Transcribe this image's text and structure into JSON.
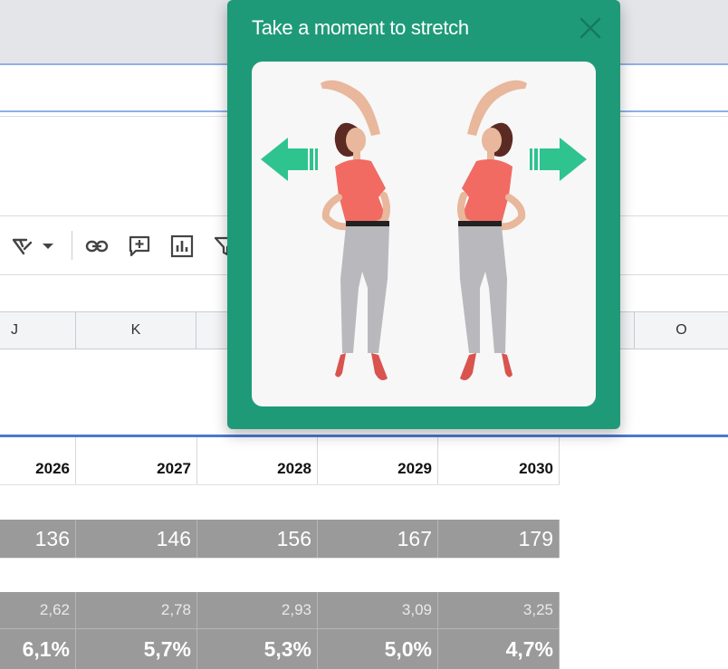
{
  "popup": {
    "title": "Take a moment to stretch",
    "close_icon": "close-icon",
    "illustration": "stretching-women-illustration",
    "arrow_left_icon": "arrow-left-icon",
    "arrow_right_icon": "arrow-right-icon"
  },
  "toolbar": {
    "icons": [
      "text-format-icon",
      "chevron-down-icon",
      "link-icon",
      "add-comment-icon",
      "insert-chart-icon",
      "filter-icon"
    ]
  },
  "column_headers": [
    "J",
    "K",
    "O"
  ],
  "sheet": {
    "years": [
      "2026",
      "2027",
      "2028",
      "2029",
      "2030"
    ],
    "row_values": [
      "136",
      "146",
      "156",
      "167",
      "179"
    ],
    "row_ratios": [
      "2,62",
      "2,78",
      "2,93",
      "3,09",
      "3,25"
    ],
    "row_percent": [
      "6,1%",
      "5,7%",
      "5,3%",
      "5,0%",
      "4,7%"
    ]
  },
  "colors": {
    "popup_bg": "#1f9a78",
    "arrow": "#2fc38f",
    "shirt": "#f16b63",
    "pants": "#b9b9bd",
    "highlight_row": "#9a9a9a",
    "selection_blue": "#4b78d2"
  }
}
